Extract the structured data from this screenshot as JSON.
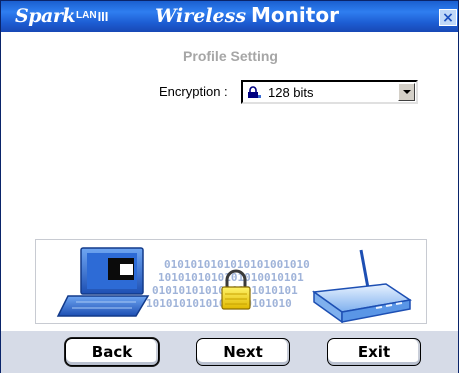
{
  "titlebar": {
    "brand": {
      "spark": "Spark",
      "lan": "LAN",
      "bars": "III"
    },
    "title_wireless": "Wireless",
    "title_monitor": "Monitor",
    "close_glyph": "×"
  },
  "page": {
    "subtitle": "Profile Setting"
  },
  "encryption": {
    "label": "Encryption :",
    "selected_value": "128 bits",
    "icon": "lock-icon"
  },
  "banner": {
    "binary_lines": [
      "0101010101010101001010",
      "1010101010101010010101",
      "0101010101010101010101",
      "1010101010101010101010"
    ]
  },
  "buttons": {
    "back": "Back",
    "next": "Next",
    "exit": "Exit"
  },
  "colors": {
    "titlebar": "#1d5dd3",
    "bottombar": "#d6dbe7",
    "binary": "#9fb3d9"
  }
}
